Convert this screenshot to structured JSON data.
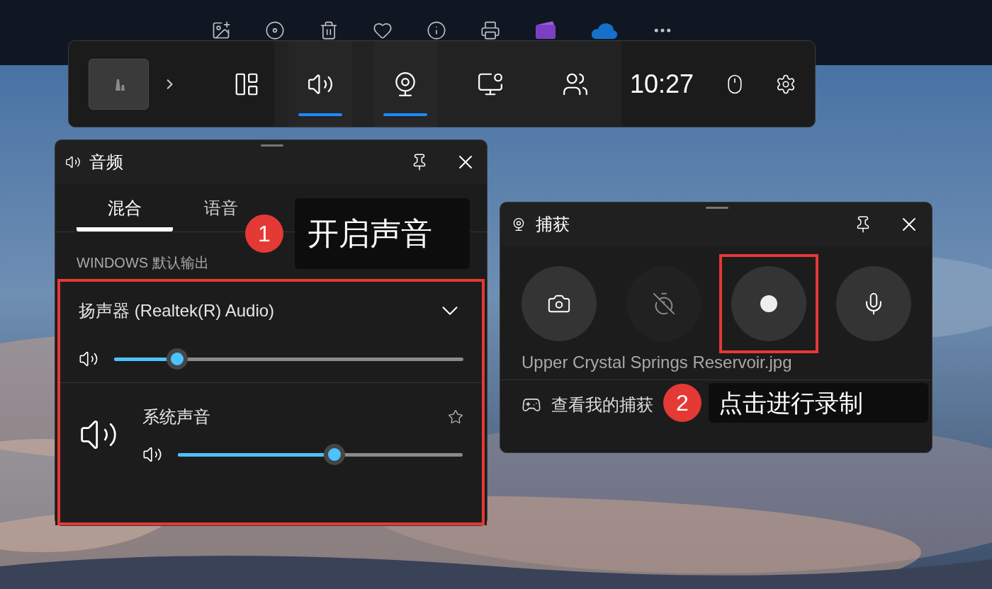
{
  "game_bar": {
    "widgets": [
      {
        "kind": "widget-menu",
        "selected": false
      },
      {
        "kind": "audio",
        "selected": true
      },
      {
        "kind": "capture",
        "selected": true
      },
      {
        "kind": "performance",
        "selected": false
      },
      {
        "kind": "social",
        "selected": false
      }
    ],
    "time": "10:27"
  },
  "audio_panel": {
    "title": "音频",
    "tabs": [
      {
        "label": "混合",
        "selected": true
      },
      {
        "label": "语音",
        "selected": false
      }
    ],
    "section_label": "WINDOWS 默认输出",
    "device": {
      "name": "扬声器 (Realtek(R) Audio)",
      "level": 0.18
    },
    "apps": [
      {
        "name": "系统声音",
        "level": 0.55,
        "favorite": false
      }
    ]
  },
  "capture_panel": {
    "title": "捕获",
    "buttons": [
      {
        "kind": "screenshot",
        "disabled": false
      },
      {
        "kind": "replay",
        "disabled": true
      },
      {
        "kind": "record",
        "disabled": false
      },
      {
        "kind": "microphone",
        "disabled": false
      }
    ],
    "last_capture": "Upper Crystal Springs Reservoir.jpg",
    "gallery_link": "查看我的捕获"
  },
  "annotations": [
    {
      "number": "1",
      "text": "开启声音"
    },
    {
      "number": "2",
      "text": "点击进行录制"
    }
  ]
}
